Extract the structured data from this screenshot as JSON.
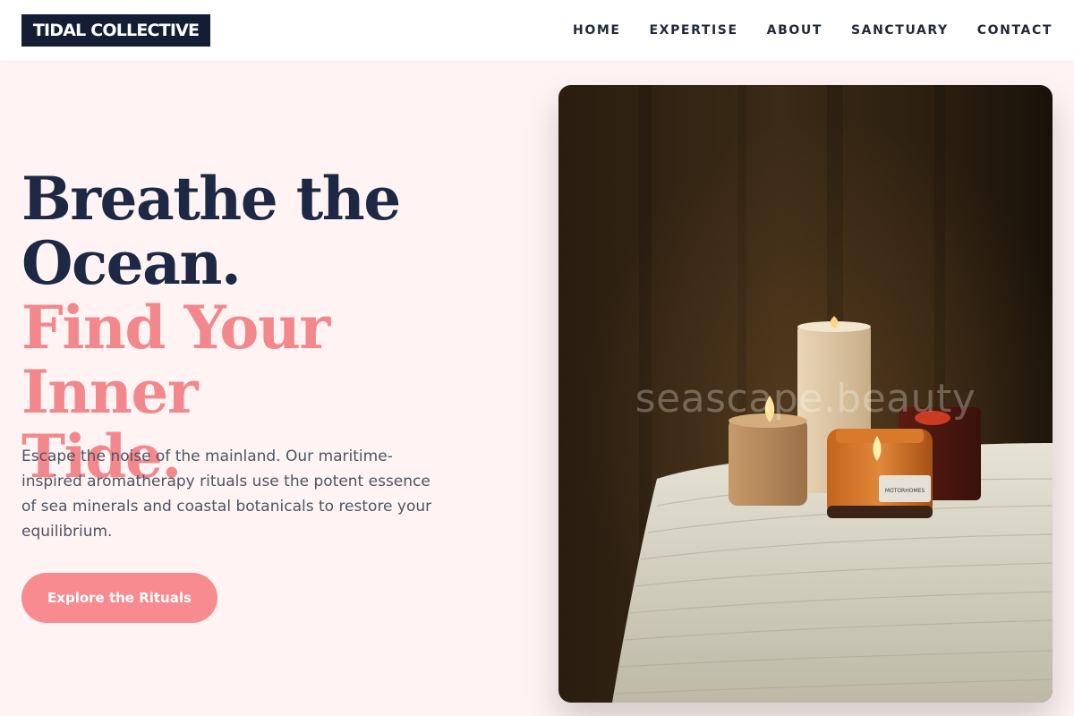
{
  "header": {
    "logo": "TIDAL COLLECTIVE",
    "nav": [
      "HOME",
      "EXPERTISE",
      "ABOUT",
      "SANCTUARY",
      "CONTACT"
    ]
  },
  "hero": {
    "title_line1": "Breathe the",
    "title_line2": "Ocean.",
    "title_line3": "Find Your Inner",
    "title_line4": "Tide.",
    "description": "Escape the noise of the mainland. Our maritime-inspired aromatherapy rituals use the potent essence of sea minerals and coastal botanicals to restore your equilibrium.",
    "cta_label": "Explore the Rituals"
  },
  "image": {
    "watermark": "seascape.beauty",
    "jar_label": "MOTORHOMES"
  },
  "colors": {
    "background": "#fff4f3",
    "navy": "#1d2944",
    "accent_pink": "#f2888c",
    "button_pink": "#f78b90",
    "logo_bg": "#131d34"
  }
}
